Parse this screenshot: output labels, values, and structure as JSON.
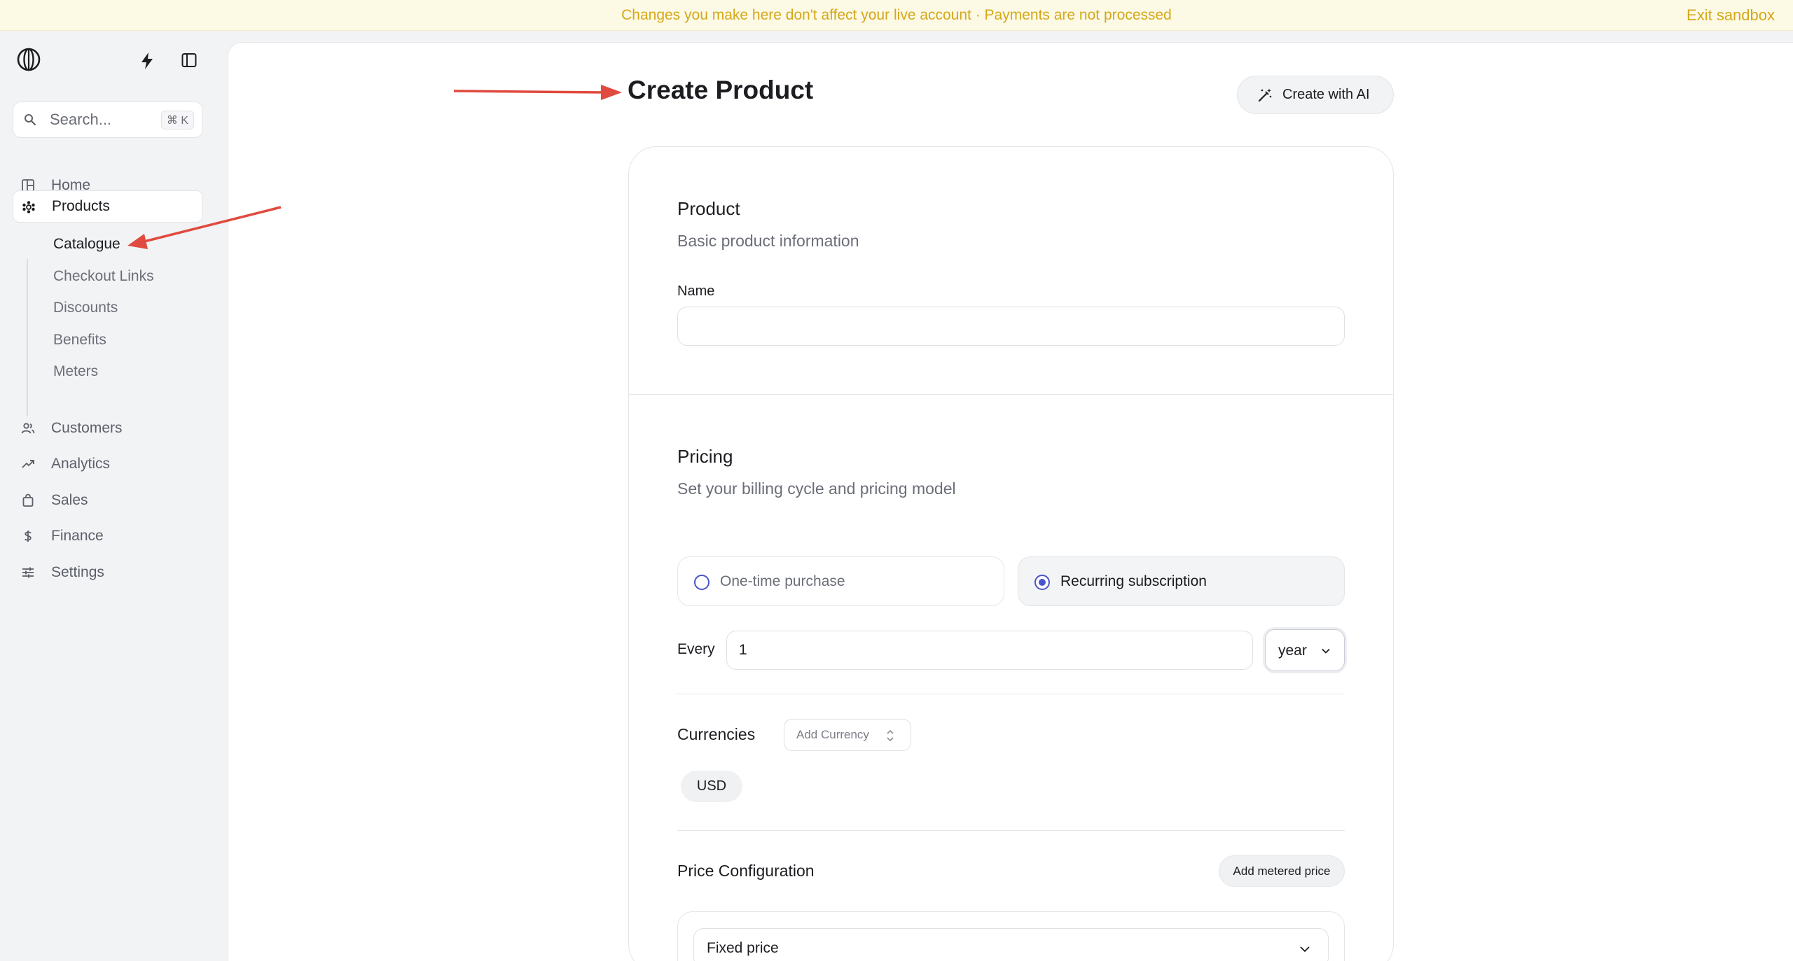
{
  "banner": {
    "message": "Changes you make here don't affect your live account · Payments are not processed",
    "exit_label": "Exit sandbox"
  },
  "sidebar": {
    "search": {
      "placeholder": "Search...",
      "shortcut": "⌘ K"
    },
    "items": [
      {
        "label": "Home",
        "icon": "home-icon"
      },
      {
        "label": "Products",
        "icon": "products-icon",
        "active": true
      },
      {
        "label": "Customers",
        "icon": "users-icon"
      },
      {
        "label": "Analytics",
        "icon": "trend-icon"
      },
      {
        "label": "Sales",
        "icon": "bag-icon"
      },
      {
        "label": "Finance",
        "icon": "dollar-icon"
      },
      {
        "label": "Settings",
        "icon": "sliders-icon"
      }
    ],
    "products_subitems": [
      {
        "label": "Catalogue",
        "active": true
      },
      {
        "label": "Checkout Links"
      },
      {
        "label": "Discounts"
      },
      {
        "label": "Benefits"
      },
      {
        "label": "Meters"
      }
    ]
  },
  "main": {
    "page_title": "Create Product",
    "ai_button_label": "Create with AI",
    "product_section": {
      "title": "Product",
      "subtitle": "Basic product information",
      "name_label": "Name",
      "name_value": ""
    },
    "pricing_section": {
      "title": "Pricing",
      "subtitle": "Set your billing cycle and pricing model",
      "options": [
        {
          "label": "One-time purchase",
          "selected": false
        },
        {
          "label": "Recurring subscription",
          "selected": true
        }
      ],
      "every_label": "Every",
      "interval_count": "1",
      "interval_unit": "year",
      "currencies_label": "Currencies",
      "add_currency_label": "Add Currency",
      "currency_chips": [
        "USD"
      ],
      "price_config_label": "Price Configuration",
      "add_metered_label": "Add metered price",
      "price_type": "Fixed price"
    }
  },
  "colors": {
    "banner_text": "#d4a819",
    "banner_bg": "#fcf9e5",
    "accent_radio": "#4b55c8",
    "annotation_arrow": "#e04a3f"
  }
}
